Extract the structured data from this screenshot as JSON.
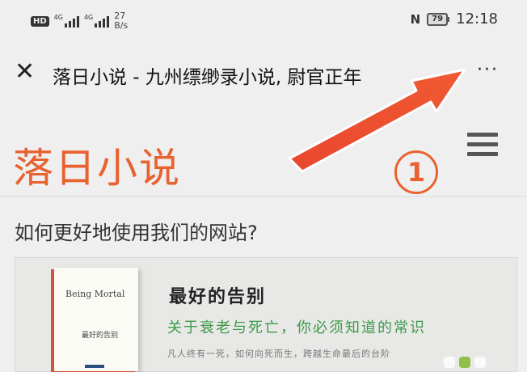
{
  "status_bar": {
    "hd": "HD",
    "signal1_label": "4G",
    "signal2_label": "4G",
    "net_speed_value": "27",
    "net_speed_unit": "B/s",
    "nfc": "N",
    "battery": "79",
    "time": "12:18"
  },
  "title_bar": {
    "close_icon": "close-icon",
    "title": "落日小说 - 九州缥缈录小说, 尉官正年",
    "more_label": "···"
  },
  "site_header": {
    "logo_text": "落日小说",
    "marker_number": "①",
    "accent_color": "#e8622f"
  },
  "content": {
    "question": "如何更好地使用我们的网站?",
    "banner": {
      "book_title_en": "Being Mortal",
      "book_title_cn": "最好的告别",
      "title": "最好的告别",
      "subtitle": "关于衰老与死亡，你必须知道的常识",
      "body": "凡人终有一死，如何向死而生，跨越生命最后的台阶",
      "subtitle_color": "#3c9a4a"
    }
  }
}
